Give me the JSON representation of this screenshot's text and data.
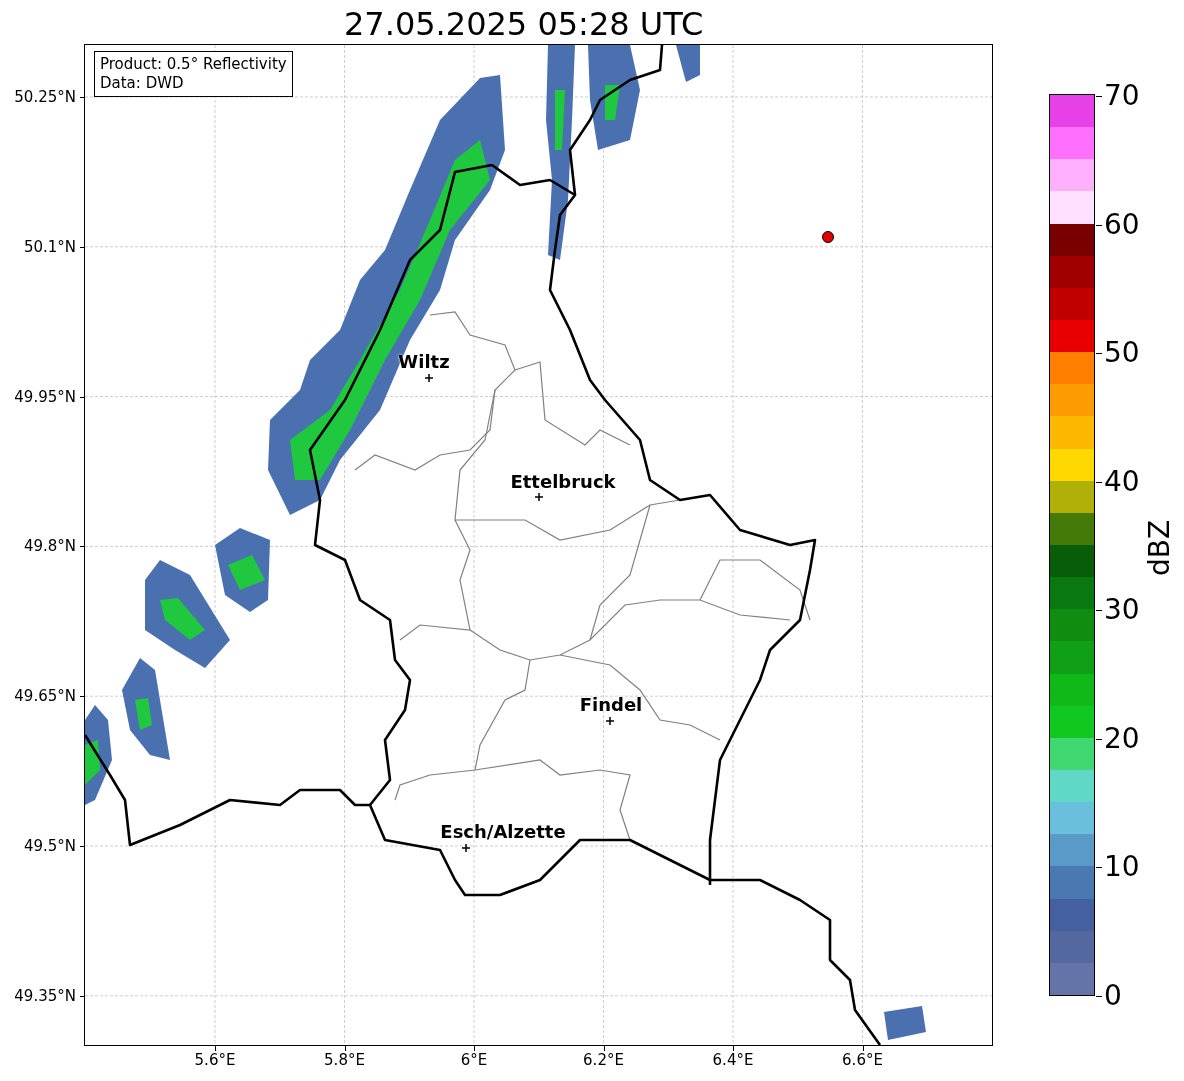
{
  "title": "27.05.2025 05:28 UTC",
  "info_box": [
    "Product: 0.5° Reflectivity",
    "Data: DWD"
  ],
  "y_ticks": [
    "50.25°N",
    "50.1°N",
    "49.95°N",
    "49.8°N",
    "49.65°N",
    "49.5°N",
    "49.35°N"
  ],
  "x_ticks": [
    "5.6°E",
    "5.8°E",
    "6°E",
    "6.2°E",
    "6.4°E",
    "6.6°E"
  ],
  "cities": [
    {
      "name": "Wiltz"
    },
    {
      "name": "Ettelbruck"
    },
    {
      "name": "Findel"
    },
    {
      "name": "Esch/Alzette"
    }
  ],
  "colorbar": {
    "label": "dBZ",
    "ticks": [
      "70",
      "60",
      "50",
      "40",
      "30",
      "20",
      "10",
      "0"
    ],
    "bands": [
      {
        "color": "#6473a8"
      },
      {
        "color": "#5468a0"
      },
      {
        "color": "#4560a0"
      },
      {
        "color": "#4a78b0"
      },
      {
        "color": "#5a9ac8"
      },
      {
        "color": "#68c0dc"
      },
      {
        "color": "#60d8c8"
      },
      {
        "color": "#40d870"
      },
      {
        "color": "#10c820"
      },
      {
        "color": "#10b818"
      },
      {
        "color": "#10a018"
      },
      {
        "color": "#108c10"
      },
      {
        "color": "#0a7810"
      },
      {
        "color": "#085e08"
      },
      {
        "color": "#447a08"
      },
      {
        "color": "#b0b008"
      },
      {
        "color": "#ffd800"
      },
      {
        "color": "#fcb800"
      },
      {
        "color": "#fc9c00"
      },
      {
        "color": "#ff8000"
      },
      {
        "color": "#e80000"
      },
      {
        "color": "#c00000"
      },
      {
        "color": "#a00000"
      },
      {
        "color": "#780000"
      },
      {
        "color": "#ffe0ff"
      },
      {
        "color": "#ffb0ff"
      },
      {
        "color": "#ff70ff"
      },
      {
        "color": "#e840e8"
      }
    ]
  }
}
